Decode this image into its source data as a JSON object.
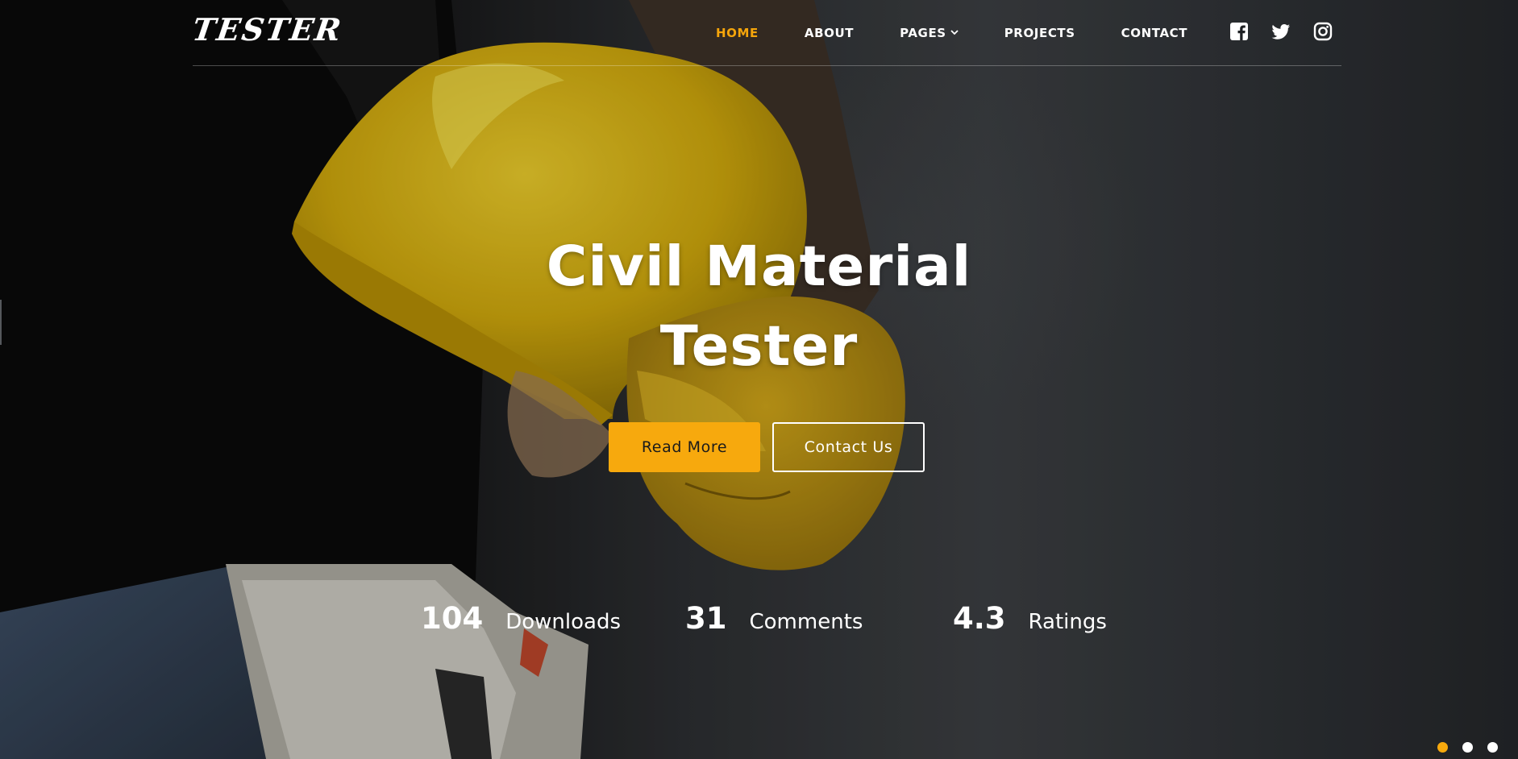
{
  "logo": "TESTER",
  "nav": {
    "items": [
      {
        "label": "HOME",
        "active": true
      },
      {
        "label": "ABOUT",
        "active": false
      },
      {
        "label": "PAGES",
        "active": false,
        "dropdown": true
      },
      {
        "label": "PROJECTS",
        "active": false
      },
      {
        "label": "CONTACT",
        "active": false
      }
    ],
    "social": [
      {
        "icon": "facebook-icon"
      },
      {
        "icon": "twitter-icon"
      },
      {
        "icon": "instagram-icon"
      }
    ]
  },
  "hero": {
    "title_line1": "Civil Material",
    "title_line2": "Tester",
    "buttons": {
      "read_more": "Read More",
      "contact_us": "Contact Us"
    },
    "stats": [
      {
        "value": "104",
        "label": "Downloads"
      },
      {
        "value": "31",
        "label": "Comments"
      },
      {
        "value": "4.3",
        "label": "Ratings"
      }
    ]
  },
  "slider": {
    "slide_count": 3,
    "active_slide": 1
  },
  "colors": {
    "accent": "#f7a90d",
    "active_nav": "#f5a50b",
    "text": "#ffffff"
  }
}
